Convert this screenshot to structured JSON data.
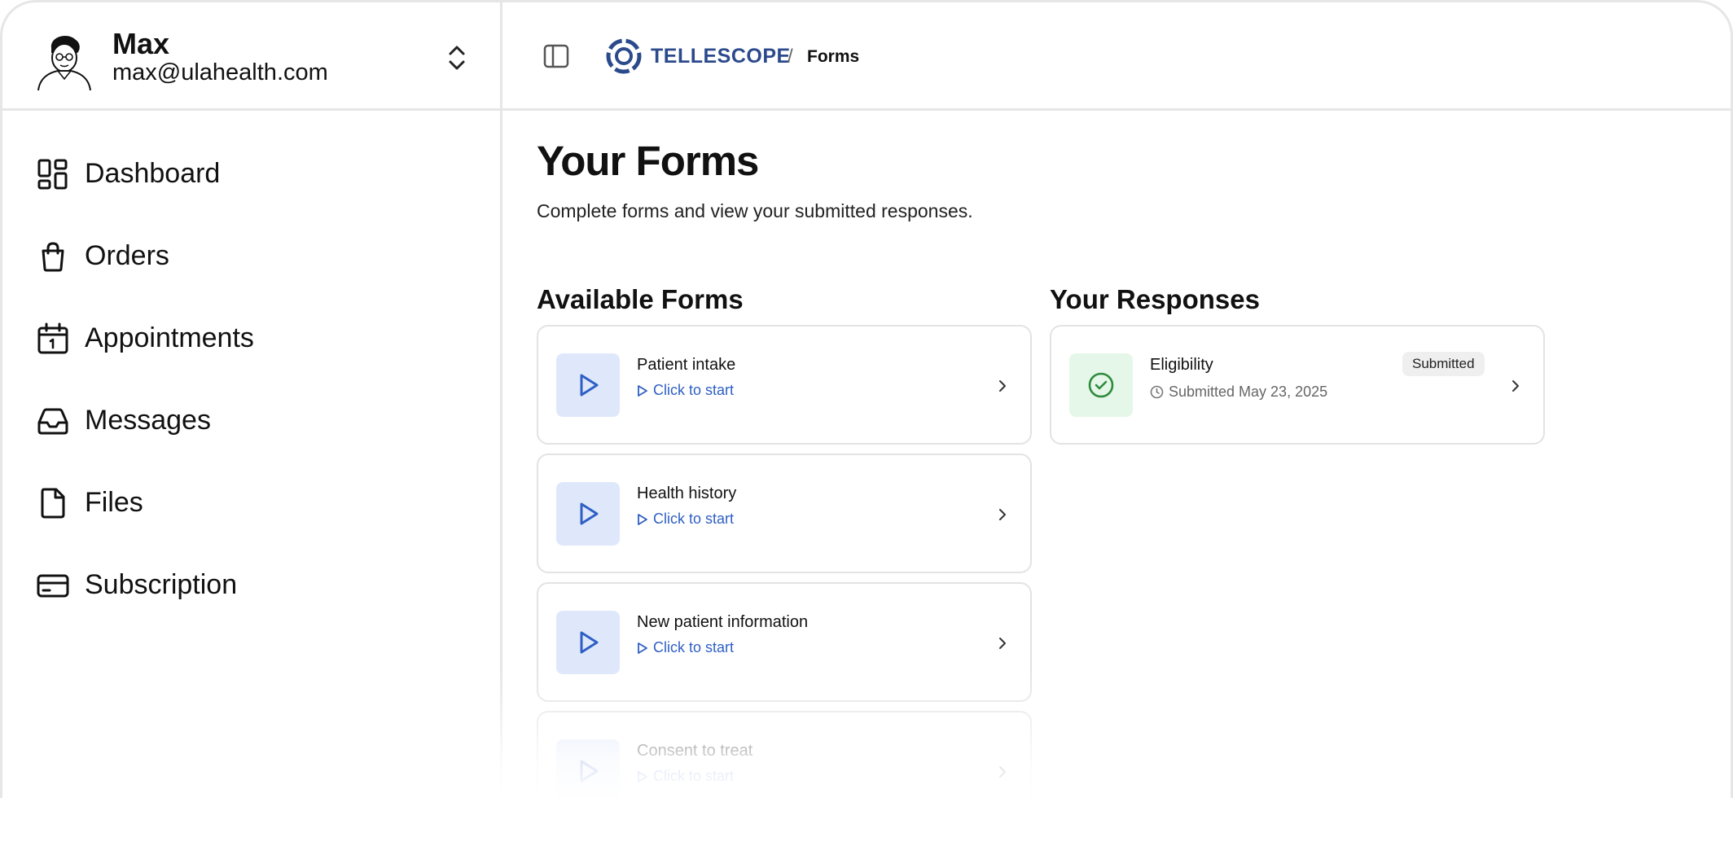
{
  "user": {
    "name": "Max",
    "email": "max@ulahealth.com"
  },
  "sidebar": {
    "items": [
      {
        "label": "Dashboard",
        "icon": "dashboard-icon"
      },
      {
        "label": "Orders",
        "icon": "shopping-bag-icon"
      },
      {
        "label": "Appointments",
        "icon": "calendar-icon"
      },
      {
        "label": "Messages",
        "icon": "inbox-icon"
      },
      {
        "label": "Files",
        "icon": "file-icon"
      },
      {
        "label": "Subscription",
        "icon": "credit-card-icon"
      }
    ]
  },
  "header": {
    "brand": "TELLESCOPE",
    "separator": "/",
    "current": "Forms"
  },
  "main": {
    "title": "Your Forms",
    "subtitle": "Complete forms and view your submitted responses.",
    "available_title": "Available Forms",
    "responses_title": "Your Responses",
    "forms": [
      {
        "title": "Patient intake",
        "action": "Click to start"
      },
      {
        "title": "Health history",
        "action": "Click to start"
      },
      {
        "title": "New patient information",
        "action": "Click to start"
      },
      {
        "title": "Consent to treat",
        "action": "Click to start"
      }
    ],
    "responses": [
      {
        "title": "Eligibility",
        "status": "Submitted",
        "date_text": "Submitted May 23, 2025"
      }
    ]
  },
  "colors": {
    "accent": "#2f5fc4",
    "brand": "#2b4a8c",
    "success": "#2e8b3e",
    "form_thumb_bg": "#dfe8fb",
    "response_thumb_bg": "#e5f7e8"
  }
}
